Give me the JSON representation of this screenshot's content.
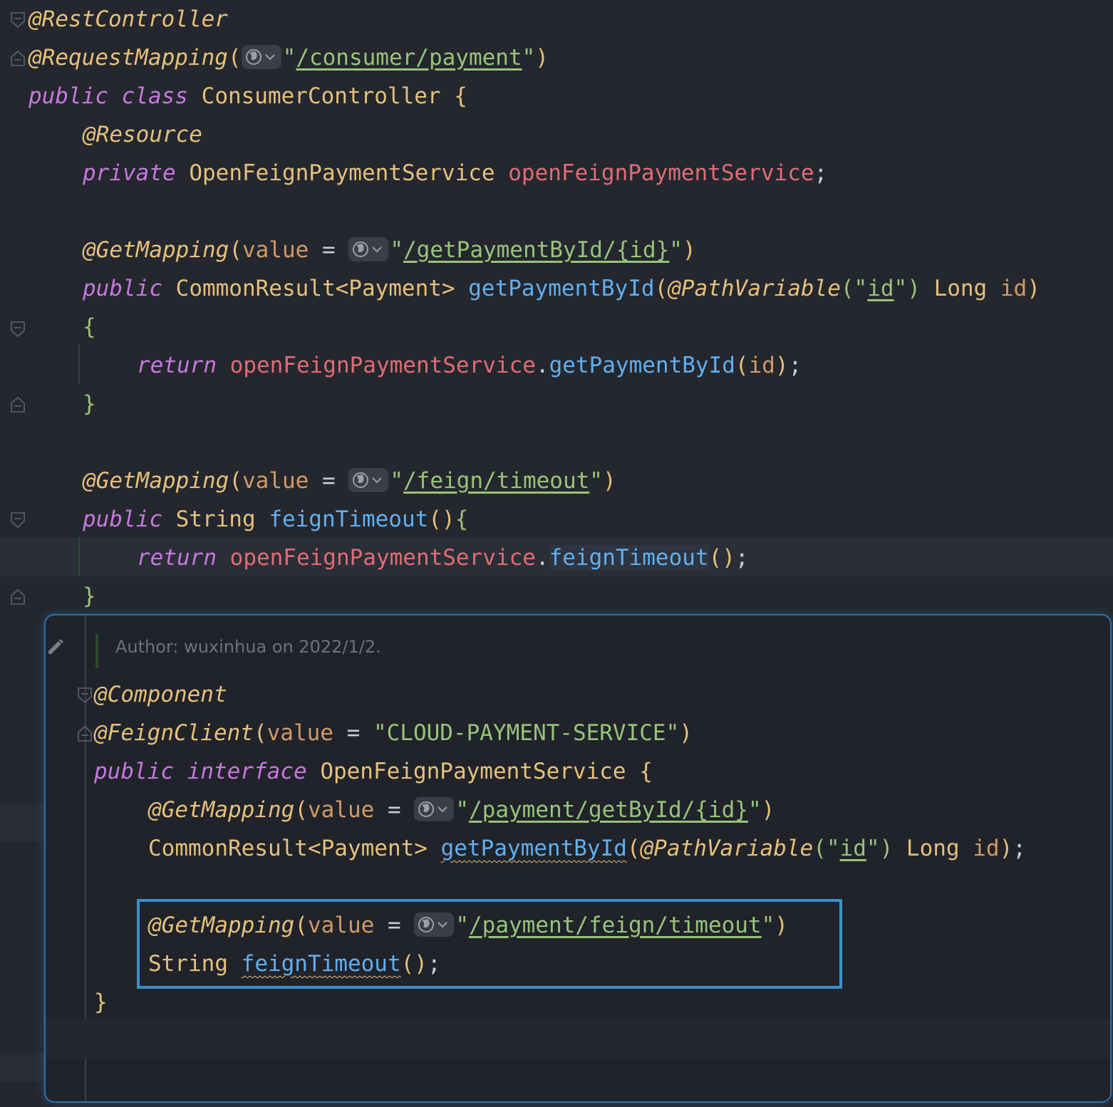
{
  "editor": {
    "lines": {
      "l1_annotation": "@RestController",
      "l2_annotation": "@RequestMapping",
      "l2_url": "/consumer/payment",
      "l3_kw1": "public",
      "l3_kw2": "class",
      "l3_class": "ConsumerController",
      "l4_annotation": "@Resource",
      "l5_kw": "private",
      "l5_type": "OpenFeignPaymentService",
      "l5_field": "openFeignPaymentService",
      "l7_annotation": "@GetMapping",
      "l7_param": "value",
      "l7_url": "/getPaymentById/{id}",
      "l8_kw": "public",
      "l8_type": "CommonResult<Payment>",
      "l8_method": "getPaymentById",
      "l8_pv": "@PathVariable",
      "l8_pv_arg": "id",
      "l8_ptype": "Long",
      "l8_pname": "id",
      "l10_kw": "return",
      "l10_field": "openFeignPaymentService",
      "l10_method": "getPaymentById",
      "l10_arg": "id",
      "l13_annotation": "@GetMapping",
      "l13_param": "value",
      "l13_url": "/feign/timeout",
      "l14_kw": "public",
      "l14_type": "String",
      "l14_method": "feignTimeout",
      "l15_kw": "return",
      "l15_field": "openFeignPaymentService",
      "l15_method": "feignTimeout"
    }
  },
  "popup": {
    "author": "Author: wuxinhua on 2022/1/2.",
    "p1_annotation": "@Component",
    "p2_annotation": "@FeignClient",
    "p2_param": "value",
    "p2_string": "\"CLOUD-PAYMENT-SERVICE\"",
    "p3_kw1": "public",
    "p3_kw2": "interface",
    "p3_type": "OpenFeignPaymentService",
    "p4_annotation": "@GetMapping",
    "p4_param": "value",
    "p4_url": "/payment/getById/{id}",
    "p5_type": "CommonResult<Payment>",
    "p5_method": "getPaymentById",
    "p5_pv": "@PathVariable",
    "p5_pv_arg": "id",
    "p5_ptype": "Long",
    "p5_pname": "id",
    "p7_annotation": "@GetMapping",
    "p7_param": "value",
    "p7_url": "/payment/feign/timeout",
    "p8_type": "String",
    "p8_method": "feignTimeout"
  },
  "icons": {
    "url_target": "globe-icon",
    "dropdown": "chevron-down-icon",
    "fold": "fold-arrow-icon",
    "edit": "pencil-icon"
  },
  "colors": {
    "background": "#24272e",
    "annotation": "#e5c07b",
    "keyword": "#c678dd",
    "field": "#e06c75",
    "method": "#61afef",
    "string": "#98c379",
    "selection_border": "#3d8fc8"
  }
}
